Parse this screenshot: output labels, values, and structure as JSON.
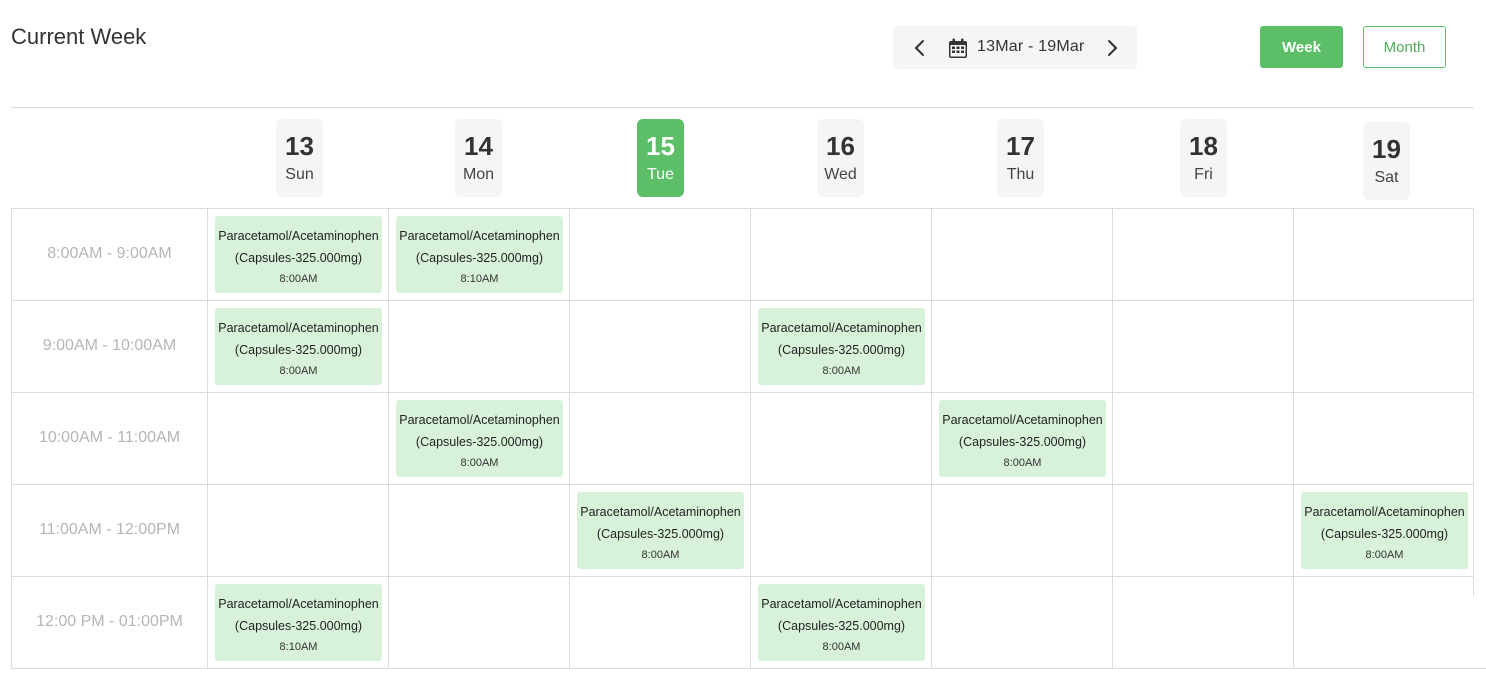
{
  "header": {
    "title": "Current Week",
    "range_label": "13Mar - 19Mar",
    "prev_icon": "chevron-left-icon",
    "next_icon": "chevron-right-icon",
    "calendar_icon": "calendar-icon"
  },
  "view_toggle": {
    "week_label": "Week",
    "month_label": "Month",
    "active": "Week"
  },
  "colors": {
    "accent": "#5cbf68",
    "event_bg": "#d8f2da",
    "grid": "#dcdcdc"
  },
  "days": [
    {
      "num": "13",
      "name": "Sun"
    },
    {
      "num": "14",
      "name": "Mon"
    },
    {
      "num": "15",
      "name": "Tue",
      "active": true
    },
    {
      "num": "16",
      "name": "Wed"
    },
    {
      "num": "17",
      "name": "Thu"
    },
    {
      "num": "18",
      "name": "Fri"
    },
    {
      "num": "19",
      "name": "Sat"
    }
  ],
  "time_slots": [
    "8:00AM - 9:00AM",
    "9:00AM - 10:00AM",
    "10:00AM - 11:00AM",
    "11:00AM - 12:00PM",
    "12:00 PM - 01:00PM"
  ],
  "events": [
    {
      "name": "Paracetamol/Acetaminophen",
      "detail": "(Capsules-325.000mg)",
      "time": "8:00AM",
      "day": "Sun",
      "slot": "8:00AM - 9:00AM"
    },
    {
      "name": "Paracetamol/Acetaminophen",
      "detail": "(Capsules-325.000mg)",
      "time": "8:10AM",
      "day": "Mon",
      "slot": "8:00AM - 9:00AM"
    },
    {
      "name": "Paracetamol/Acetaminophen",
      "detail": "(Capsules-325.000mg)",
      "time": "8:00AM",
      "day": "Sun",
      "slot": "9:00AM - 10:00AM"
    },
    {
      "name": "Paracetamol/Acetaminophen",
      "detail": "(Capsules-325.000mg)",
      "time": "8:00AM",
      "day": "Wed",
      "slot": "9:00AM - 10:00AM"
    },
    {
      "name": "Paracetamol/Acetaminophen",
      "detail": "(Capsules-325.000mg)",
      "time": "8:00AM",
      "day": "Mon",
      "slot": "10:00AM - 11:00AM"
    },
    {
      "name": "Paracetamol/Acetaminophen",
      "detail": "(Capsules-325.000mg)",
      "time": "8:00AM",
      "day": "Thu",
      "slot": "10:00AM - 11:00AM"
    },
    {
      "name": "Paracetamol/Acetaminophen",
      "detail": "(Capsules-325.000mg)",
      "time": "8:00AM",
      "day": "Tue",
      "slot": "11:00AM - 12:00PM"
    },
    {
      "name": "Paracetamol/Acetaminophen",
      "detail": "(Capsules-325.000mg)",
      "time": "8:00AM",
      "day": "Sat",
      "slot": "11:00AM - 12:00PM"
    },
    {
      "name": "Paracetamol/Acetaminophen",
      "detail": "(Capsules-325.000mg)",
      "time": "8:10AM",
      "day": "Sun",
      "slot": "12:00 PM - 01:00PM"
    },
    {
      "name": "Paracetamol/Acetaminophen",
      "detail": "(Capsules-325.000mg)",
      "time": "8:00AM",
      "day": "Wed",
      "slot": "12:00 PM - 01:00PM"
    }
  ]
}
